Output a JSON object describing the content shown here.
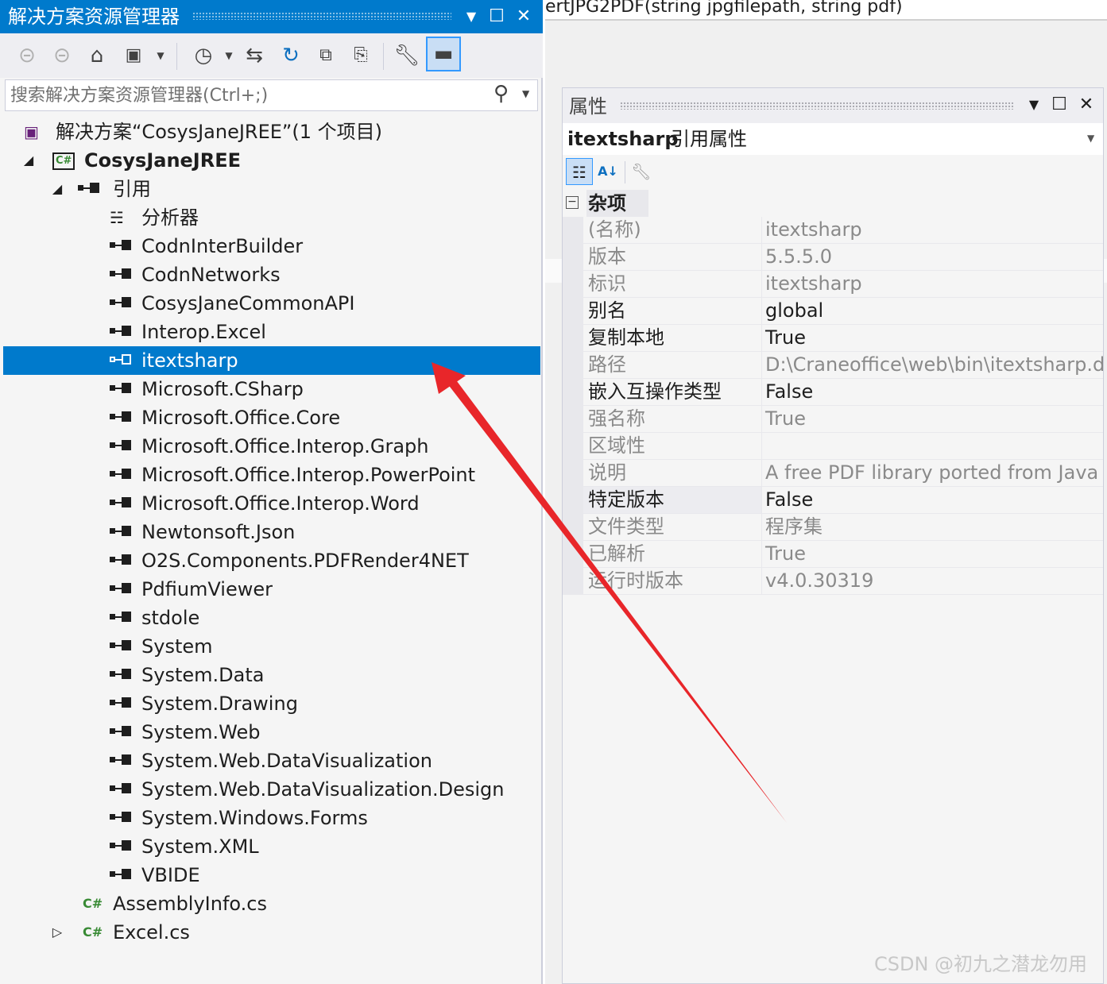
{
  "solution_explorer": {
    "title": "解决方案资源管理器",
    "search_placeholder": "搜索解决方案资源管理器(Ctrl+;)",
    "tree": [
      {
        "indent": 0,
        "icon": "solution-icon",
        "label": "解决方案“CosysJaneJREE”(1 个项目)",
        "expander": ""
      },
      {
        "indent": 1,
        "icon": "csharp-project-icon",
        "label": "CosysJaneJREE",
        "expander": "expanded",
        "bold": true
      },
      {
        "indent": 2,
        "icon": "references-icon",
        "label": "引用",
        "expander": "expanded"
      },
      {
        "indent": 3,
        "icon": "analyzer-icon",
        "label": "分析器"
      },
      {
        "indent": 3,
        "icon": "reference-icon",
        "label": "CodnInterBuilder"
      },
      {
        "indent": 3,
        "icon": "reference-icon",
        "label": "CodnNetworks"
      },
      {
        "indent": 3,
        "icon": "reference-icon",
        "label": "CosysJaneCommonAPI"
      },
      {
        "indent": 3,
        "icon": "reference-icon",
        "label": "Interop.Excel"
      },
      {
        "indent": 3,
        "icon": "reference-icon",
        "label": "itextsharp",
        "selected": true
      },
      {
        "indent": 3,
        "icon": "reference-icon",
        "label": "Microsoft.CSharp"
      },
      {
        "indent": 3,
        "icon": "reference-icon",
        "label": "Microsoft.Office.Core"
      },
      {
        "indent": 3,
        "icon": "reference-icon",
        "label": "Microsoft.Office.Interop.Graph"
      },
      {
        "indent": 3,
        "icon": "reference-icon",
        "label": "Microsoft.Office.Interop.PowerPoint"
      },
      {
        "indent": 3,
        "icon": "reference-icon",
        "label": "Microsoft.Office.Interop.Word"
      },
      {
        "indent": 3,
        "icon": "reference-icon",
        "label": "Newtonsoft.Json"
      },
      {
        "indent": 3,
        "icon": "reference-icon",
        "label": "O2S.Components.PDFRender4NET"
      },
      {
        "indent": 3,
        "icon": "reference-icon",
        "label": "PdfiumViewer"
      },
      {
        "indent": 3,
        "icon": "reference-icon",
        "label": "stdole"
      },
      {
        "indent": 3,
        "icon": "reference-icon",
        "label": "System"
      },
      {
        "indent": 3,
        "icon": "reference-icon",
        "label": "System.Data"
      },
      {
        "indent": 3,
        "icon": "reference-icon",
        "label": "System.Drawing"
      },
      {
        "indent": 3,
        "icon": "reference-icon",
        "label": "System.Web"
      },
      {
        "indent": 3,
        "icon": "reference-icon",
        "label": "System.Web.DataVisualization"
      },
      {
        "indent": 3,
        "icon": "reference-icon",
        "label": "System.Web.DataVisualization.Design"
      },
      {
        "indent": 3,
        "icon": "reference-icon",
        "label": "System.Windows.Forms"
      },
      {
        "indent": 3,
        "icon": "reference-icon",
        "label": "System.XML"
      },
      {
        "indent": 3,
        "icon": "reference-icon",
        "label": "VBIDE"
      },
      {
        "indent": 2,
        "icon": "csharp-file-icon",
        "label": "AssemblyInfo.cs"
      },
      {
        "indent": 2,
        "icon": "csharp-file-icon",
        "label": "Excel.cs",
        "expander": "collapsed"
      }
    ]
  },
  "editor": {
    "signature_text": "ertJPG2PDF(string jpgfilepath, string pdf)"
  },
  "properties": {
    "title": "属性",
    "object_name": "itextsharp",
    "object_type": "引用属性",
    "category": "杂项",
    "rows": [
      {
        "key": "(名称)",
        "value": "itextsharp",
        "readonly": true
      },
      {
        "key": "版本",
        "value": "5.5.5.0",
        "readonly": true
      },
      {
        "key": "标识",
        "value": "itextsharp",
        "readonly": true
      },
      {
        "key": "别名",
        "value": "global",
        "readonly": false
      },
      {
        "key": "复制本地",
        "value": "True",
        "readonly": false
      },
      {
        "key": "路径",
        "value": "D:\\Craneoffice\\web\\bin\\itextsharp.dll",
        "readonly": true
      },
      {
        "key": "嵌入互操作类型",
        "value": "False",
        "readonly": false
      },
      {
        "key": "强名称",
        "value": "True",
        "readonly": true
      },
      {
        "key": "区域性",
        "value": "",
        "readonly": true
      },
      {
        "key": "说明",
        "value": "A free PDF library ported from Java iT",
        "readonly": true
      },
      {
        "key": "特定版本",
        "value": "False",
        "readonly": false,
        "highlight": true
      },
      {
        "key": "文件类型",
        "value": "程序集",
        "readonly": true
      },
      {
        "key": "已解析",
        "value": "True",
        "readonly": true
      },
      {
        "key": "运行时版本",
        "value": "v4.0.30319",
        "readonly": true
      }
    ]
  },
  "watermark": "CSDN @初九之潜龙勿用",
  "colors": {
    "accent": "#007acc",
    "arrow": "#e8262a",
    "csharp": "#388a34"
  }
}
